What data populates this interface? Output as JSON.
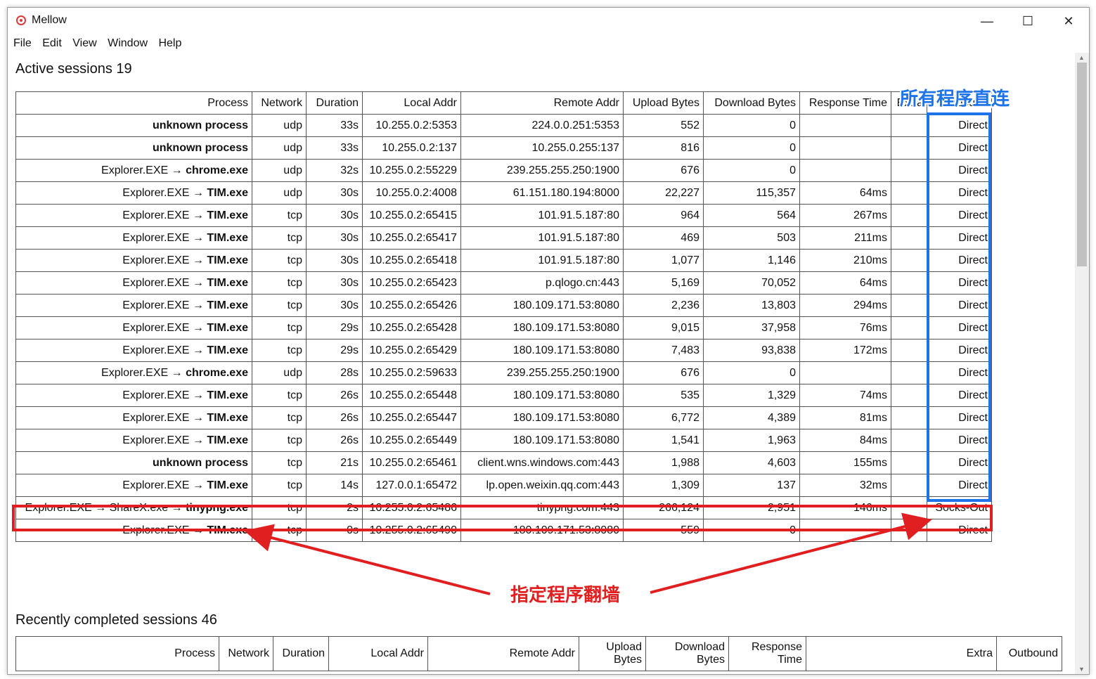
{
  "window": {
    "title": "Mellow",
    "minimize_label": "—",
    "maximize_label": "☐",
    "close_label": "✕"
  },
  "menu": [
    "File",
    "Edit",
    "View",
    "Window",
    "Help"
  ],
  "active": {
    "heading": "Active sessions 19",
    "columns": [
      "Process",
      "Network",
      "Duration",
      "Local Addr",
      "Remote Addr",
      "Upload Bytes",
      "Download Bytes",
      "Response Time",
      "Extra",
      "Outbound"
    ],
    "rows": [
      {
        "process_prefix": "",
        "process_bold": "unknown process",
        "network": "udp",
        "duration": "33s",
        "local": "10.255.0.2:5353",
        "remote": "224.0.0.251:5353",
        "up": "552",
        "down": "0",
        "resp": "",
        "extra": "",
        "outbound": "Direct"
      },
      {
        "process_prefix": "",
        "process_bold": "unknown process",
        "network": "udp",
        "duration": "33s",
        "local": "10.255.0.2:137",
        "remote": "10.255.0.255:137",
        "up": "816",
        "down": "0",
        "resp": "",
        "extra": "",
        "outbound": "Direct"
      },
      {
        "process_prefix": "Explorer.EXE → ",
        "process_bold": "chrome.exe",
        "network": "udp",
        "duration": "32s",
        "local": "10.255.0.2:55229",
        "remote": "239.255.255.250:1900",
        "up": "676",
        "down": "0",
        "resp": "",
        "extra": "",
        "outbound": "Direct"
      },
      {
        "process_prefix": "Explorer.EXE → ",
        "process_bold": "TIM.exe",
        "network": "udp",
        "duration": "30s",
        "local": "10.255.0.2:4008",
        "remote": "61.151.180.194:8000",
        "up": "22,227",
        "down": "115,357",
        "resp": "64ms",
        "extra": "",
        "outbound": "Direct"
      },
      {
        "process_prefix": "Explorer.EXE → ",
        "process_bold": "TIM.exe",
        "network": "tcp",
        "duration": "30s",
        "local": "10.255.0.2:65415",
        "remote": "101.91.5.187:80",
        "up": "964",
        "down": "564",
        "resp": "267ms",
        "extra": "",
        "outbound": "Direct"
      },
      {
        "process_prefix": "Explorer.EXE → ",
        "process_bold": "TIM.exe",
        "network": "tcp",
        "duration": "30s",
        "local": "10.255.0.2:65417",
        "remote": "101.91.5.187:80",
        "up": "469",
        "down": "503",
        "resp": "211ms",
        "extra": "",
        "outbound": "Direct"
      },
      {
        "process_prefix": "Explorer.EXE → ",
        "process_bold": "TIM.exe",
        "network": "tcp",
        "duration": "30s",
        "local": "10.255.0.2:65418",
        "remote": "101.91.5.187:80",
        "up": "1,077",
        "down": "1,146",
        "resp": "210ms",
        "extra": "",
        "outbound": "Direct"
      },
      {
        "process_prefix": "Explorer.EXE → ",
        "process_bold": "TIM.exe",
        "network": "tcp",
        "duration": "30s",
        "local": "10.255.0.2:65423",
        "remote": "p.qlogo.cn:443",
        "up": "5,169",
        "down": "70,052",
        "resp": "64ms",
        "extra": "",
        "outbound": "Direct"
      },
      {
        "process_prefix": "Explorer.EXE → ",
        "process_bold": "TIM.exe",
        "network": "tcp",
        "duration": "30s",
        "local": "10.255.0.2:65426",
        "remote": "180.109.171.53:8080",
        "up": "2,236",
        "down": "13,803",
        "resp": "294ms",
        "extra": "",
        "outbound": "Direct"
      },
      {
        "process_prefix": "Explorer.EXE → ",
        "process_bold": "TIM.exe",
        "network": "tcp",
        "duration": "29s",
        "local": "10.255.0.2:65428",
        "remote": "180.109.171.53:8080",
        "up": "9,015",
        "down": "37,958",
        "resp": "76ms",
        "extra": "",
        "outbound": "Direct"
      },
      {
        "process_prefix": "Explorer.EXE → ",
        "process_bold": "TIM.exe",
        "network": "tcp",
        "duration": "29s",
        "local": "10.255.0.2:65429",
        "remote": "180.109.171.53:8080",
        "up": "7,483",
        "down": "93,838",
        "resp": "172ms",
        "extra": "",
        "outbound": "Direct"
      },
      {
        "process_prefix": "Explorer.EXE → ",
        "process_bold": "chrome.exe",
        "network": "udp",
        "duration": "28s",
        "local": "10.255.0.2:59633",
        "remote": "239.255.255.250:1900",
        "up": "676",
        "down": "0",
        "resp": "",
        "extra": "",
        "outbound": "Direct"
      },
      {
        "process_prefix": "Explorer.EXE → ",
        "process_bold": "TIM.exe",
        "network": "tcp",
        "duration": "26s",
        "local": "10.255.0.2:65448",
        "remote": "180.109.171.53:8080",
        "up": "535",
        "down": "1,329",
        "resp": "74ms",
        "extra": "",
        "outbound": "Direct"
      },
      {
        "process_prefix": "Explorer.EXE → ",
        "process_bold": "TIM.exe",
        "network": "tcp",
        "duration": "26s",
        "local": "10.255.0.2:65447",
        "remote": "180.109.171.53:8080",
        "up": "6,772",
        "down": "4,389",
        "resp": "81ms",
        "extra": "",
        "outbound": "Direct"
      },
      {
        "process_prefix": "Explorer.EXE → ",
        "process_bold": "TIM.exe",
        "network": "tcp",
        "duration": "26s",
        "local": "10.255.0.2:65449",
        "remote": "180.109.171.53:8080",
        "up": "1,541",
        "down": "1,963",
        "resp": "84ms",
        "extra": "",
        "outbound": "Direct"
      },
      {
        "process_prefix": "",
        "process_bold": "unknown process",
        "network": "tcp",
        "duration": "21s",
        "local": "10.255.0.2:65461",
        "remote": "client.wns.windows.com:443",
        "up": "1,988",
        "down": "4,603",
        "resp": "155ms",
        "extra": "",
        "outbound": "Direct"
      },
      {
        "process_prefix": "Explorer.EXE → ",
        "process_bold": "TIM.exe",
        "network": "tcp",
        "duration": "14s",
        "local": "127.0.0.1:65472",
        "remote": "lp.open.weixin.qq.com:443",
        "up": "1,309",
        "down": "137",
        "resp": "32ms",
        "extra": "",
        "outbound": "Direct"
      },
      {
        "process_prefix": "Explorer.EXE → ShareX.exe → ",
        "process_bold": "tinypng.exe",
        "network": "tcp",
        "duration": "2s",
        "local": "10.255.0.2:65486",
        "remote": "tinypng.com:443",
        "up": "266,124",
        "down": "2,951",
        "resp": "146ms",
        "extra": "",
        "outbound": "Socks-Out"
      },
      {
        "process_prefix": "Explorer.EXE → ",
        "process_bold": "TIM.exe",
        "network": "tcp",
        "duration": "0s",
        "local": "10.255.0.2:65490",
        "remote": "180.109.171.53:8080",
        "up": "559",
        "down": "0",
        "resp": "",
        "extra": "",
        "outbound": "Direct"
      }
    ]
  },
  "completed": {
    "heading": "Recently completed sessions 46",
    "columns": [
      "Process",
      "Network",
      "Duration",
      "Local Addr",
      "Remote Addr",
      "Upload Bytes",
      "Download Bytes",
      "Response Time",
      "Extra",
      "Outbound"
    ]
  },
  "annotations": {
    "direct_label": "所有程序直连",
    "proxy_label": "指定程序翻墙",
    "blue": "#1e73e8",
    "red": "#e02020"
  }
}
